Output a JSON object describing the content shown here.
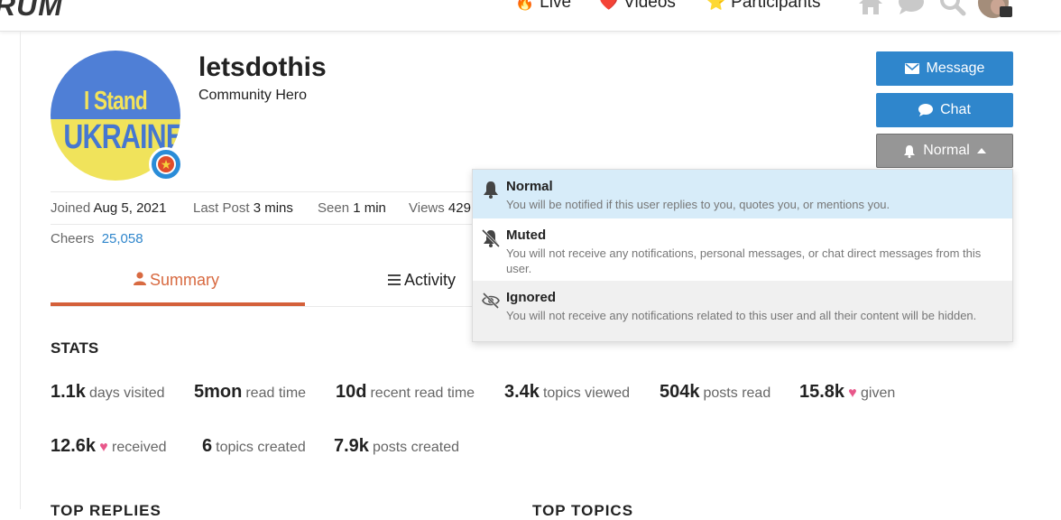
{
  "header": {
    "logo_text": "RUM",
    "nav": [
      {
        "emoji": "🔥",
        "label": "Live"
      },
      {
        "emoji": "❤️",
        "label": "Videos"
      },
      {
        "emoji": "⭐",
        "label": "Participants"
      }
    ],
    "icons": [
      "home-icon",
      "chat-bubble-icon",
      "search-icon",
      "user-avatar"
    ]
  },
  "profile": {
    "username": "letsdothis",
    "title": "Community Hero",
    "avatar_text_line1": "I Stand With",
    "avatar_text_line2": "UKRAINE",
    "flair_icon": "star-icon",
    "meta": {
      "joined_label": "Joined",
      "joined_value": "Aug 5, 2021",
      "last_post_label": "Last Post",
      "last_post_value": "3 mins",
      "seen_label": "Seen",
      "seen_value": "1 min",
      "views_label": "Views",
      "views_value": "429",
      "cheers_label": "Cheers",
      "cheers_value": "25,058"
    }
  },
  "actions": {
    "message_label": "Message",
    "chat_label": "Chat",
    "notification_label": "Normal"
  },
  "tabs": [
    {
      "label": "Summary",
      "active": true,
      "icon": "user-icon"
    },
    {
      "label": "Activity",
      "active": false,
      "icon": "list-icon"
    }
  ],
  "stats": {
    "heading": "STATS",
    "items": [
      {
        "num": "1.1k",
        "label": "days visited"
      },
      {
        "num": "5mon",
        "label": "read time"
      },
      {
        "num": "10d",
        "label": "recent read time"
      },
      {
        "num": "3.4k",
        "label": "topics viewed"
      },
      {
        "num": "504k",
        "label": "posts read"
      },
      {
        "num": "15.8k",
        "label": "given"
      },
      {
        "num": "12.6k",
        "label": "received"
      },
      {
        "num": "6",
        "label": "topics created"
      },
      {
        "num": "7.9k",
        "label": "posts created"
      }
    ]
  },
  "section_headings": [
    "TOP REPLIES",
    "TOP TOPICS"
  ],
  "notification_menu": {
    "items": [
      {
        "title": "Normal",
        "desc": "You will be notified if this user replies to you, quotes you, or mentions you.",
        "selected": true
      },
      {
        "title": "Muted",
        "desc": "You will not receive any notifications, personal messages, or chat direct messages from this user.",
        "selected": false
      },
      {
        "title": "Ignored",
        "desc": "You will not receive any notifications related to this user and all their content will be hidden.",
        "selected": false
      }
    ]
  },
  "colors": {
    "accent_blue": "#2f86cc",
    "tab_active": "#d4603a",
    "heart": "#e8578a",
    "menu_selected_bg": "#d7ecf9",
    "menu_hover_bg": "#f0f0f0"
  }
}
